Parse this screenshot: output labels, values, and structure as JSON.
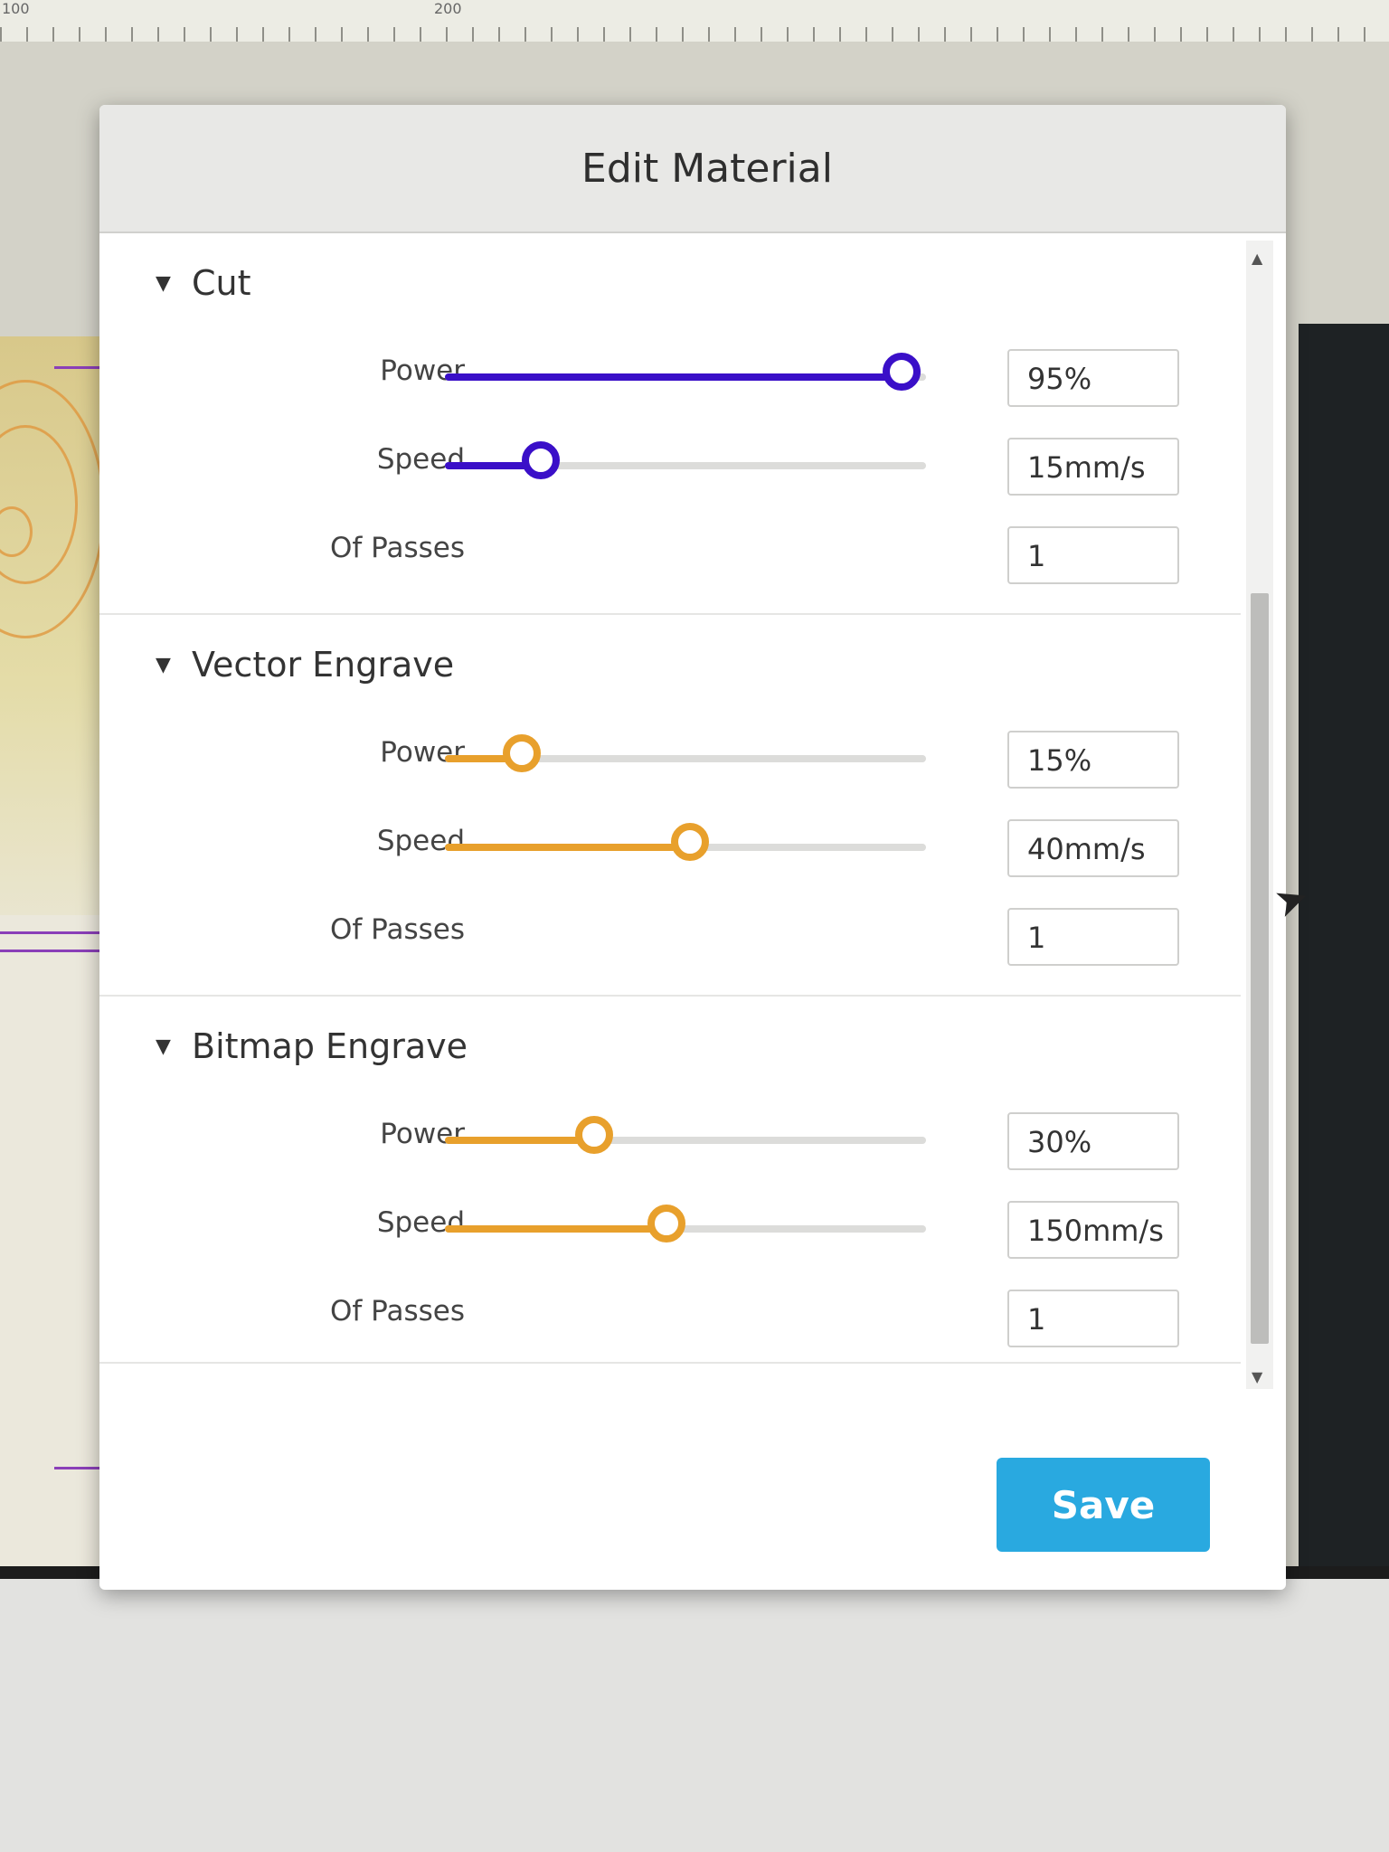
{
  "ruler": {
    "labels": [
      "100",
      "200"
    ]
  },
  "dialog": {
    "title": "Edit Material",
    "save_label": "Save"
  },
  "sections": [
    {
      "title": "Cut",
      "color": "#3a0fc8",
      "rows": [
        {
          "label": "Power",
          "value": "95%",
          "slider": 0.95
        },
        {
          "label": "Speed",
          "value": "15mm/s",
          "slider": 0.2
        },
        {
          "label": "Of Passes",
          "value": "1"
        }
      ]
    },
    {
      "title": "Vector Engrave",
      "color": "#e8a02c",
      "rows": [
        {
          "label": "Power",
          "value": "15%",
          "slider": 0.16
        },
        {
          "label": "Speed",
          "value": "40mm/s",
          "slider": 0.51
        },
        {
          "label": "Of Passes",
          "value": "1"
        }
      ]
    },
    {
      "title": "Bitmap Engrave",
      "color": "#e8a02c",
      "rows": [
        {
          "label": "Power",
          "value": "30%",
          "slider": 0.31
        },
        {
          "label": "Speed",
          "value": "150mm/s",
          "slider": 0.46
        },
        {
          "label": "Of Passes",
          "value": "1"
        }
      ]
    }
  ],
  "icons": {
    "caret": "triangle-down-icon",
    "scroll_up": "scroll-up-arrow-icon",
    "scroll_down": "scroll-down-arrow-icon",
    "cursor": "mouse-cursor-icon"
  }
}
